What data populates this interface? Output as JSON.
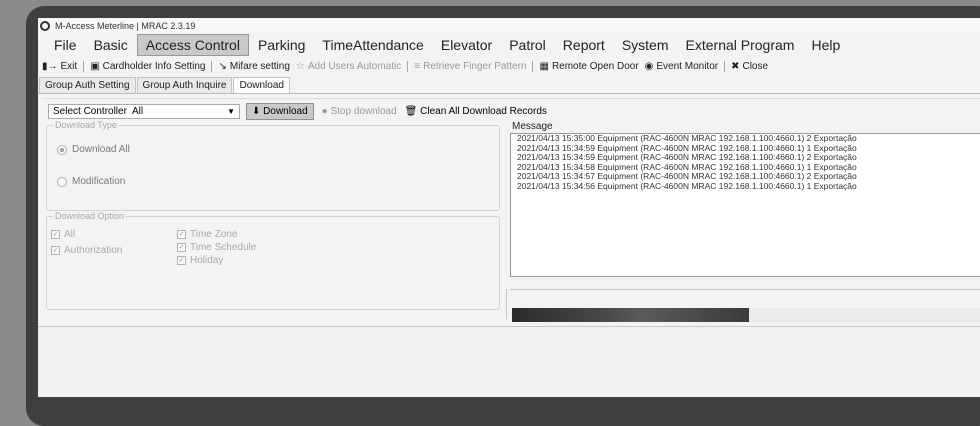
{
  "window": {
    "title": "M-Access Meterline | MRAC 2.3.19"
  },
  "menu": [
    "File",
    "Basic",
    "Access Control",
    "Parking",
    "TimeAttendance",
    "Elevator",
    "Patrol",
    "Report",
    "System",
    "External Program",
    "Help"
  ],
  "menu_active": "Access Control",
  "toolbar": {
    "exit": "Exit",
    "cardholder": "Cardholder Info Setting",
    "mifare": "Mifare setting",
    "add_users": "Add Users Automatic",
    "retrieve": "Retrieve Finger Pattern",
    "remote_open": "Remote Open Door",
    "event_monitor": "Event Monitor",
    "close": "Close"
  },
  "tabs": [
    "Group Auth Setting",
    "Group Auth Inquire",
    "Download"
  ],
  "tab_active": "Download",
  "controls": {
    "select_label": "Select Controller",
    "select_value": "All",
    "download": "Download",
    "stop_download": "Stop download",
    "clean_all": "Clean All Download Records"
  },
  "download_type": {
    "legend": "Download Type",
    "download_all": "Download All",
    "modification": "Modification"
  },
  "download_option": {
    "legend": "Download Option",
    "all": "All",
    "authorization": "Authorization",
    "time_zone": "Time Zone",
    "time_schedule": "Time Schedule",
    "holiday": "Holiday"
  },
  "message": {
    "label": "Message",
    "lines": [
      "2021/04/13 15:35:00 Equipment (RAC-4600N MRAC 192.168.1.100:4660.1)  2 Exportação",
      "2021/04/13 15:34:59 Equipment (RAC-4600N MRAC 192.168.1.100:4660.1)  1 Exportação",
      "2021/04/13 15:34:59 Equipment (RAC-4600N MRAC 192.168.1.100:4660.1)  2 Exportação",
      "2021/04/13 15:34:58 Equipment (RAC-4600N MRAC 192.168.1.100:4660.1)  1 Exportação",
      "2021/04/13 15:34:57 Equipment (RAC-4600N MRAC 192.168.1.100:4660.1)  2 Exportação",
      "2021/04/13 15:34:56 Equipment (RAC-4600N MRAC 192.168.1.100:4660.1)  1 Exportação"
    ]
  },
  "progress": {
    "value": 0.5
  }
}
